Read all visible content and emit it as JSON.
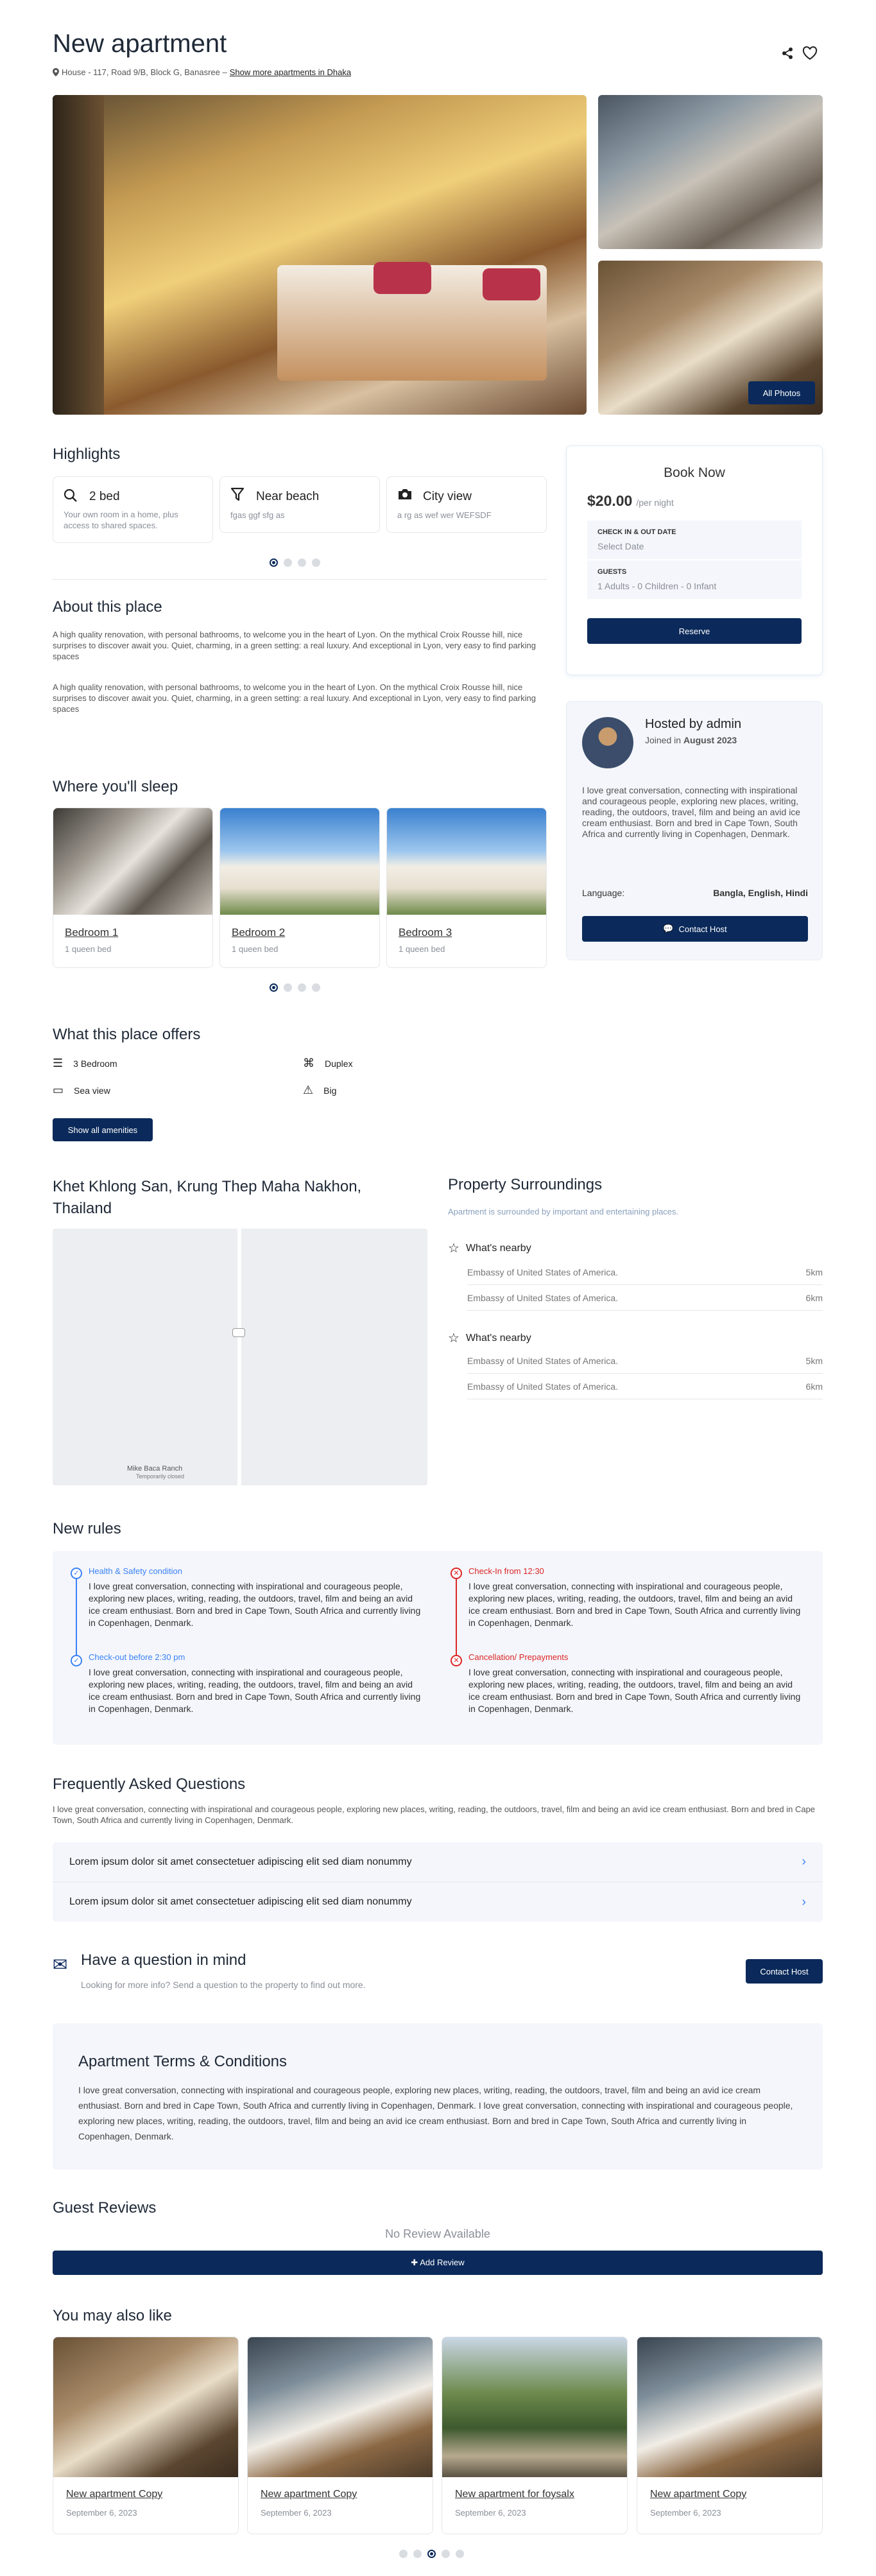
{
  "header": {
    "title": "New apartment",
    "address": "House - 117, Road 9/B, Block G, Banasree –",
    "more_link": "Show more apartments in Dhaka",
    "share_icon": "share-icon",
    "favorite_icon": "heart-icon"
  },
  "gallery": {
    "all_photos_label": "All Photos"
  },
  "highlights": {
    "title": "Highlights",
    "items": [
      {
        "icon": "search-icon",
        "title": "2 bed",
        "text": "Your own room in a home, plus access to shared spaces."
      },
      {
        "icon": "filter-icon",
        "title": "Near beach",
        "text": "fgas ggf sfg as"
      },
      {
        "icon": "camera-icon",
        "title": "City view",
        "text": "a rg as wef wer WEFSDF"
      }
    ]
  },
  "booking": {
    "title": "Book Now",
    "price": "$20.00",
    "per": "/per night",
    "checkin_label": "CHECK IN & OUT DATE",
    "checkin_value": "Select Date",
    "guests_label": "GUESTS",
    "guests_value": "1 Adults - 0 Children - 0 Infant",
    "reserve_label": "Reserve"
  },
  "about": {
    "title": "About this place",
    "paragraphs": [
      "A high quality renovation, with personal bathrooms, to welcome you in the heart of Lyon. On the mythical Croix Rousse hill, nice surprises to discover await you. Quiet, charming, in a green setting: a real luxury. And exceptional in Lyon, very easy to find parking spaces",
      "A high quality renovation, with personal bathrooms, to welcome you in the heart of Lyon. On the mythical Croix Rousse hill, nice surprises to discover await you. Quiet, charming, in a green setting: a real luxury. And exceptional in Lyon, very easy to find parking spaces"
    ]
  },
  "host": {
    "title": "Hosted by admin",
    "joined_prefix": "Joined in",
    "joined_value": "August 2023",
    "bio": "I love great conversation, connecting with inspirational and courageous people, exploring new places, writing, reading, the outdoors, travel, film and being an avid ice cream enthusiast. Born and bred in Cape Town, South Africa and currently living in Copenhagen, Denmark.",
    "language_label": "Language:",
    "language_value": "Bangla, English, Hindi",
    "contact_label": "Contact Host"
  },
  "sleep": {
    "title": "Where you'll sleep",
    "rooms": [
      {
        "name": "Bedroom 1",
        "bed": "1 queen bed"
      },
      {
        "name": "Bedroom 2",
        "bed": "1 queen bed"
      },
      {
        "name": "Bedroom 3",
        "bed": "1 queen bed"
      }
    ]
  },
  "offers": {
    "title": "What this place offers",
    "items": [
      {
        "icon": "bed-icon",
        "label": "3 Bedroom"
      },
      {
        "icon": "layout-icon",
        "label": "Duplex"
      },
      {
        "icon": "tv-icon",
        "label": "Sea view"
      },
      {
        "icon": "warning-icon",
        "label": "Big"
      }
    ],
    "button": "Show all amenities"
  },
  "map": {
    "title": "Khet Khlong San, Krung Thep Maha Nakhon, Thailand",
    "poi": "Mike Baca Ranch",
    "poi_note": "Temporarily closed"
  },
  "surroundings": {
    "title": "Property Surroundings",
    "subtitle": "Apartment is surrounded by important and entertaining places.",
    "groups": [
      {
        "title": "What's nearby",
        "items": [
          {
            "name": "Embassy of United States of America.",
            "dist": "5km"
          },
          {
            "name": "Embassy of United States of America.",
            "dist": "6km"
          }
        ]
      },
      {
        "title": "What's nearby",
        "items": [
          {
            "name": "Embassy of United States of America.",
            "dist": "5km"
          },
          {
            "name": "Embassy of United States of America.",
            "dist": "6km"
          }
        ]
      }
    ]
  },
  "rules": {
    "title": "New rules",
    "left": [
      {
        "title": "Health & Safety condition",
        "text": "I love great conversation, connecting with inspirational and courageous people, exploring new places, writing, reading, the outdoors, travel, film and being an avid ice cream enthusiast. Born and bred in Cape Town, South Africa and currently living in Copenhagen, Denmark."
      },
      {
        "title": "Check-out before 2:30 pm",
        "text": "I love great conversation, connecting with inspirational and courageous people, exploring new places, writing, reading, the outdoors, travel, film and being an avid ice cream enthusiast. Born and bred in Cape Town, South Africa and currently living in Copenhagen, Denmark."
      }
    ],
    "right": [
      {
        "title": "Check-In from 12:30",
        "text": "I love great conversation, connecting with inspirational and courageous people, exploring new places, writing, reading, the outdoors, travel, film and being an avid ice cream enthusiast. Born and bred in Cape Town, South Africa and currently living in Copenhagen, Denmark."
      },
      {
        "title": "Cancellation/ Prepayments",
        "text": "I love great conversation, connecting with inspirational and courageous people, exploring new places, writing, reading, the outdoors, travel, film and being an avid ice cream enthusiast. Born and bred in Cape Town, South Africa and currently living in Copenhagen, Denmark."
      }
    ],
    "left_color": "#3b82f6",
    "right_color": "#dc2626"
  },
  "faq": {
    "title": "Frequently Asked Questions",
    "intro": "I love great conversation, connecting with inspirational and courageous people, exploring new places, writing, reading, the outdoors, travel, film and being an avid ice cream enthusiast. Born and bred in Cape Town, South Africa and currently living in Copenhagen, Denmark.",
    "items": [
      "Lorem ipsum dolor sit amet consectetuer adipiscing elit sed diam nonummy",
      "Lorem ipsum dolor sit amet consectetuer adipiscing elit sed diam nonummy"
    ]
  },
  "question": {
    "title": "Have a question in mind",
    "text": "Looking for more info? Send a question to the property to find out more.",
    "button": "Contact Host"
  },
  "terms": {
    "title": "Apartment Terms & Conditions",
    "text": "I love great conversation, connecting with inspirational and courageous people, exploring new places, writing, reading, the outdoors, travel, film and being an avid ice cream enthusiast. Born and bred in Cape Town, South Africa and currently living in Copenhagen, Denmark. I love great conversation, connecting with inspirational and courageous people, exploring new places, writing, reading, the outdoors, travel, film and being an avid ice cream enthusiast. Born and bred in Cape Town, South Africa and currently living in Copenhagen, Denmark."
  },
  "reviews": {
    "title": "Guest Reviews",
    "empty": "No Review Available",
    "add_button": "✚ Add Review"
  },
  "also": {
    "title": "You may also like",
    "items": [
      {
        "name": "New apartment Copy",
        "date": "September 6, 2023"
      },
      {
        "name": "New apartment Copy",
        "date": "September 6, 2023"
      },
      {
        "name": "New apartment for foysalx",
        "date": "September 6, 2023"
      },
      {
        "name": "New apartment Copy",
        "date": "September 6, 2023"
      }
    ]
  },
  "colors": {
    "brand": "#0b2a5b",
    "panel": "#f4f6fb"
  }
}
